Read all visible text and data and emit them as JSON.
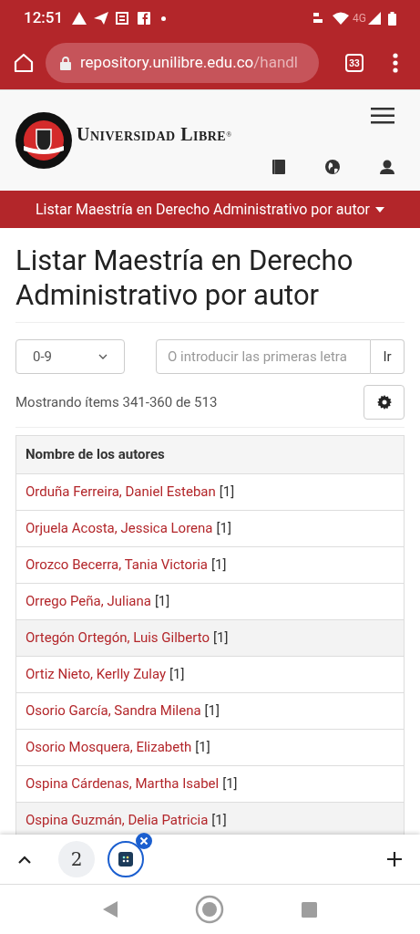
{
  "status_bar": {
    "time": "12:51",
    "network": "4G"
  },
  "browser": {
    "url_host": "repository.unilibre.edu.co",
    "url_path": "/handl",
    "tab_count": "33"
  },
  "header": {
    "logo_text": "Universidad Libre",
    "logo_mark": "®"
  },
  "nav": {
    "label": "Listar Maestría en Derecho Administrativo por autor"
  },
  "page": {
    "title": "Listar Maestría en Derecho Administrativo por autor",
    "range_select": {
      "value": "0-9"
    },
    "search": {
      "placeholder": "O introducir las primeras letra",
      "button": "Ir"
    },
    "summary": "Mostrando ítems 341-360 de 513",
    "table": {
      "column": "Nombre de los autores",
      "rows": [
        {
          "name": "Orduña Ferreira, Daniel Esteban",
          "count": "[1]",
          "shaded": false
        },
        {
          "name": "Orjuela Acosta, Jessica Lorena",
          "count": "[1]",
          "shaded": false
        },
        {
          "name": "Orozco Becerra, Tania Victoria",
          "count": "[1]",
          "shaded": false
        },
        {
          "name": "Orrego Peña, Juliana",
          "count": "[1]",
          "shaded": false
        },
        {
          "name": "Ortegón Ortegón, Luis Gilberto",
          "count": "[1]",
          "shaded": true
        },
        {
          "name": "Ortiz Nieto, Kerlly Zulay",
          "count": "[1]",
          "shaded": false
        },
        {
          "name": "Osorio García, Sandra Milena",
          "count": "[1]",
          "shaded": false
        },
        {
          "name": "Osorio Mosquera, Elizabeth",
          "count": "[1]",
          "shaded": false
        },
        {
          "name": "Ospina Cárdenas, Martha Isabel",
          "count": "[1]",
          "shaded": false
        },
        {
          "name": "Ospina Guzmán, Delia Patricia",
          "count": "[1]",
          "shaded": true
        }
      ]
    }
  },
  "tab_strip": {
    "group_count": "2"
  }
}
